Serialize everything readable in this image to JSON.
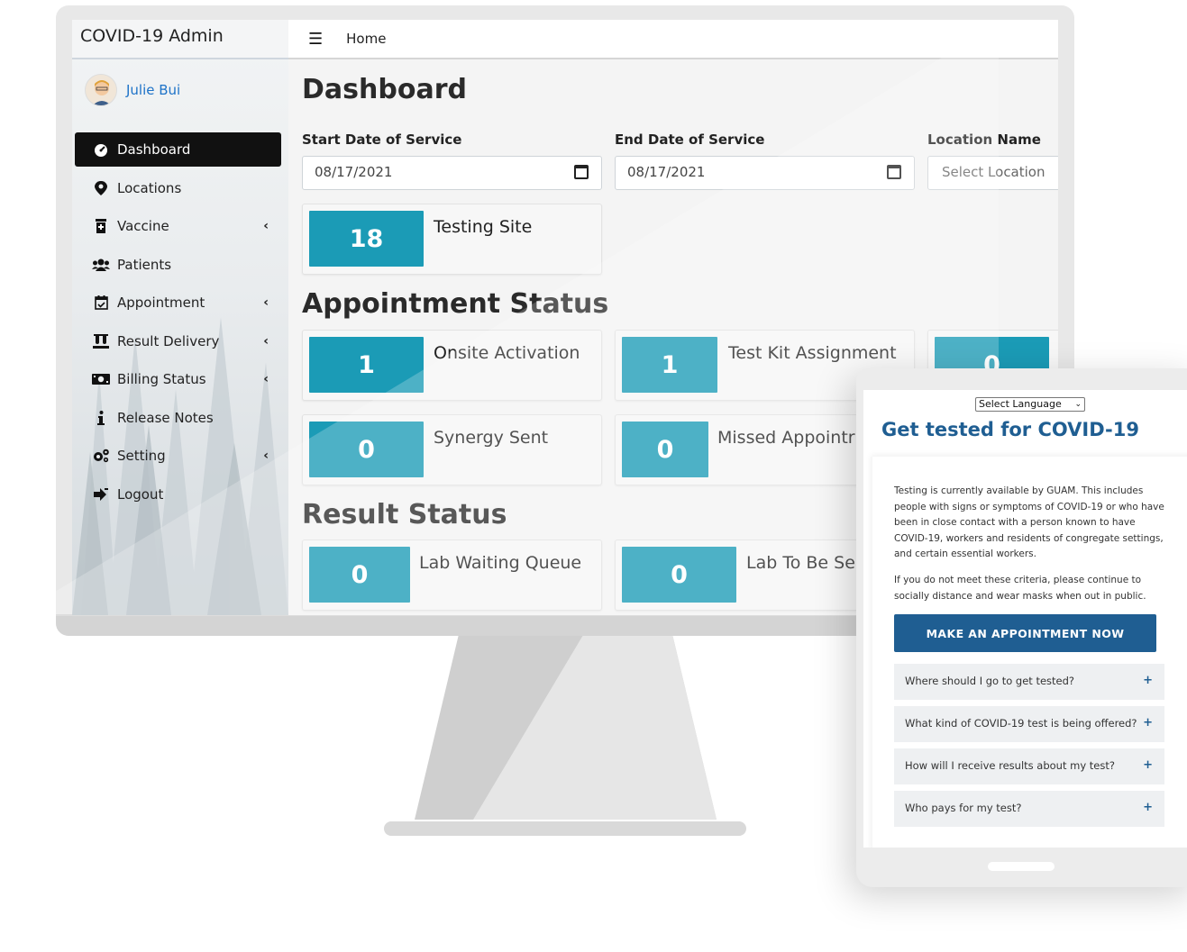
{
  "app": {
    "title": "COVID-19 Admin"
  },
  "user": {
    "name": "Julie Bui"
  },
  "sidebar": {
    "items": [
      {
        "label": "Dashboard",
        "icon": "tachometer-icon"
      },
      {
        "label": "Locations",
        "icon": "map-marker-icon"
      },
      {
        "label": "Vaccine",
        "icon": "prescription-bottle-icon",
        "caret": "‹"
      },
      {
        "label": "Patients",
        "icon": "users-icon"
      },
      {
        "label": "Appointment",
        "icon": "calendar-check-icon",
        "caret": "‹"
      },
      {
        "label": "Result Delivery",
        "icon": "vials-icon",
        "caret": "‹"
      },
      {
        "label": "Billing Status",
        "icon": "money-bill-icon",
        "caret": "‹"
      },
      {
        "label": "Release Notes",
        "icon": "info-icon"
      },
      {
        "label": "Setting",
        "icon": "cogs-icon",
        "caret": "‹"
      },
      {
        "label": "Logout",
        "icon": "sign-out-icon"
      }
    ]
  },
  "topbar": {
    "breadcrumb": "Home"
  },
  "main": {
    "title": "Dashboard",
    "filters": {
      "start_label": "Start Date of Service",
      "start_value": "08/17/2021",
      "end_label": "End Date of Service",
      "end_value": "08/17/2021",
      "location_label": "Location Name",
      "location_placeholder": "Select Location"
    },
    "testing_site": {
      "count": "18",
      "label": "Testing Site"
    },
    "appointment_section": "Appointment Status",
    "appointment_cards": [
      {
        "count": "1",
        "label": "Onsite Activation"
      },
      {
        "count": "1",
        "label": "Test Kit Assignment"
      },
      {
        "count": "0",
        "label": ""
      },
      {
        "count": "0",
        "label": "Synergy Sent"
      },
      {
        "count": "0",
        "label": "Missed Appointr"
      }
    ],
    "result_section": "Result Status",
    "result_cards": [
      {
        "count": "0",
        "label": "Lab Waiting Queue"
      },
      {
        "count": "0",
        "label": "Lab To Be Se"
      }
    ]
  },
  "tablet": {
    "language_select": "Select Language",
    "title": "Get tested for COVID-19",
    "paragraph1": "Testing is currently available by GUAM. This includes people with signs or symptoms of COVID-19 or who have been in close contact with a person known to have COVID-19, workers and residents of congregate settings, and certain essential workers.",
    "paragraph2": "If you do not meet these criteria, please continue to socially distance and wear masks when out in public.",
    "cta": "MAKE AN APPOINTMENT NOW",
    "faqs": [
      "Where should I go to get tested?",
      "What kind of COVID-19 test is being offered?",
      "How will I receive results about my test?",
      "Who pays for my test?"
    ],
    "faq_toggle": "+"
  },
  "colors": {
    "accent": "#1b9bb6",
    "brand_blue": "#1f5e92",
    "user_link": "#1e73c8",
    "active_nav": "#111111"
  }
}
